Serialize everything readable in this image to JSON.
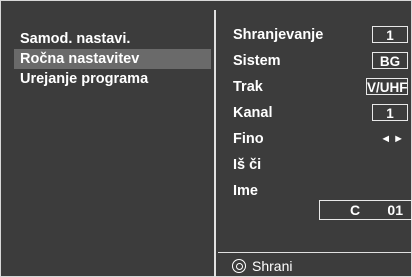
{
  "menu": {
    "items": [
      {
        "label": "Samod. nastavi.",
        "selected": false
      },
      {
        "label": "Ročna nastavitev",
        "selected": true
      },
      {
        "label": "Urejanje programa",
        "selected": false
      }
    ]
  },
  "settings": {
    "storage_label": "Shranjevanje",
    "storage_value": "1",
    "system_label": "Sistem",
    "system_value": "BG",
    "band_label": "Trak",
    "band_value": "V/UHF",
    "channel_label": "Kanal",
    "channel_value": "1",
    "fine_label": "Fino",
    "fine_arrows": "◄►",
    "search_label": "Iš či",
    "name_label": "Ime",
    "name_prefix": "C",
    "name_number": "01"
  },
  "footer": {
    "save_label": "Shrani",
    "ok_icon": "ok-circle-icon"
  }
}
